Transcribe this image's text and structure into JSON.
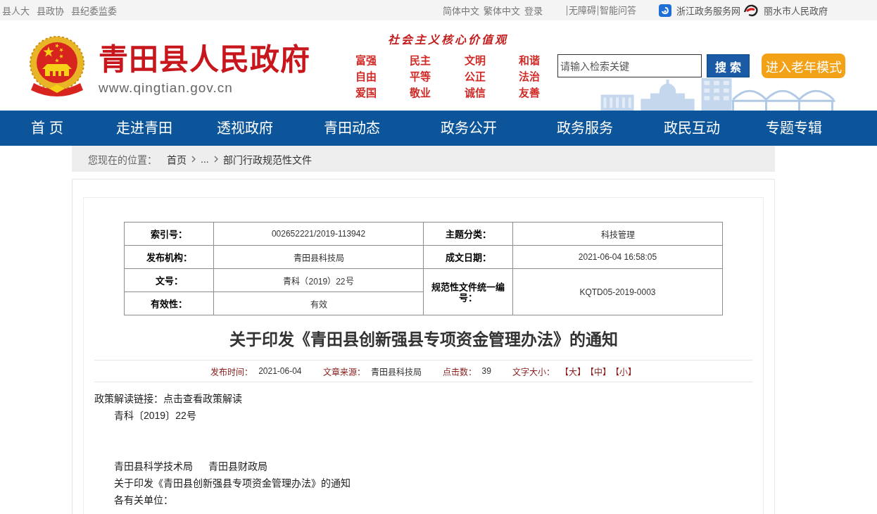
{
  "top_bar": {
    "left_links": [
      "县人大",
      "县政协",
      "县纪委监委"
    ],
    "language_links": [
      "简体中文",
      "繁体中文"
    ],
    "login_link": "登录",
    "service_links": [
      "无障碍",
      "智能问答"
    ],
    "partner_sites": [
      {
        "kind": "zhejiang",
        "label": "浙江政务服务网"
      },
      {
        "kind": "lishui",
        "label": "丽水市人民政府"
      }
    ]
  },
  "header": {
    "site_title": "青田县人民政府",
    "site_url": "www.qingtian.gov.cn",
    "core_values": {
      "heading": "社会主义核心价值观",
      "values": [
        "富强",
        "民主",
        "文明",
        "和谐",
        "自由",
        "平等",
        "公正",
        "法治",
        "爱国",
        "敬业",
        "诚信",
        "友善"
      ]
    },
    "search": {
      "placeholder": "请输入检索关键",
      "button": "搜 索"
    },
    "elder_mode_button": "进入老年模式"
  },
  "nav": [
    "首 页",
    "走进青田",
    "透视政府",
    "青田动态",
    "政务公开",
    "政务服务",
    "政民互动",
    "专题专辑"
  ],
  "breadcrumb": {
    "label": "您现在的位置：",
    "items": [
      "首页",
      "...",
      "部门行政规范性文件"
    ]
  },
  "info_table": {
    "rows": [
      [
        {
          "label": "索引号：",
          "value": "002652221/2019-113942"
        },
        {
          "label": "主题分类：",
          "value": "科技管理"
        }
      ],
      [
        {
          "label": "发布机构：",
          "value": "青田县科技局"
        },
        {
          "label": "成文日期：",
          "value": "2021-06-04 16:58:05"
        }
      ],
      [
        {
          "label": "文号：",
          "value": "青科（2019）22号"
        },
        {
          "label": "规范性文件统一编号：",
          "value": "KQTD05-2019-0003",
          "rowspan": 2
        }
      ],
      [
        {
          "label": "有效性：",
          "value": "有效"
        }
      ]
    ]
  },
  "article": {
    "title": "关于印发《青田县创新强县专项资金管理办法》的通知",
    "meta": [
      {
        "label": "发布时间：",
        "value": "2021-06-04"
      },
      {
        "label": "文章来源：",
        "value": "青田县科技局"
      },
      {
        "label": "点击数：",
        "value": "39"
      }
    ],
    "font_size": {
      "label": "文字大小：",
      "options": [
        "【大】",
        "【中】",
        "【小】"
      ]
    },
    "policy_link": {
      "label": "政策解读链接：",
      "link": "点击查看政策解读"
    },
    "body_blocks": [
      [
        "青科〔2019〕22号"
      ],
      [
        "青田县科学技术局　  青田县财政局",
        "关于印发《青田县创新强县专项资金管理办法》的通知",
        "各有关单位："
      ]
    ]
  }
}
